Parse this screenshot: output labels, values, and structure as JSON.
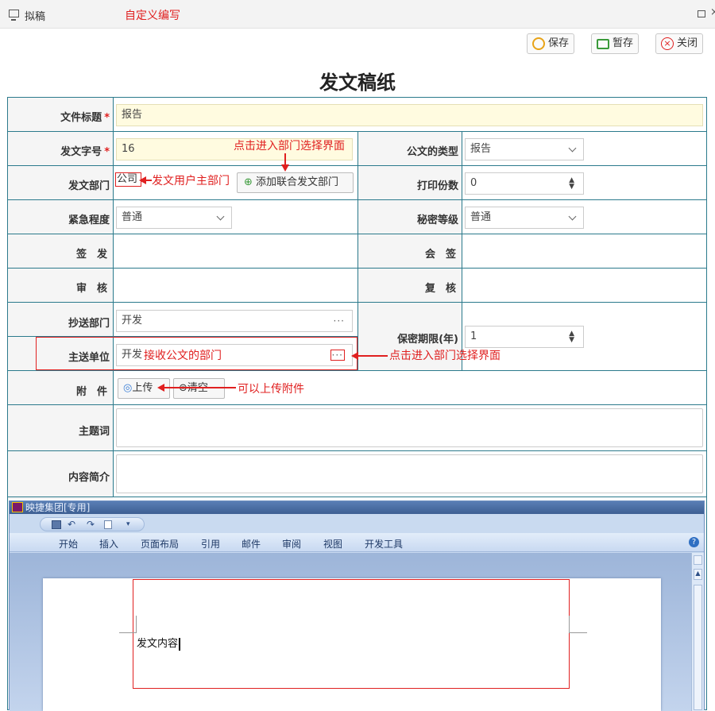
{
  "window": {
    "title": "拟稿",
    "custom_note": "自定义编写",
    "close_glyph": "×"
  },
  "toolbar": {
    "save_label": "保存",
    "draft_label": "暂存",
    "close_label": "关闭"
  },
  "doc_title": "发文稿纸",
  "form": {
    "file_title": {
      "label": "文件标题",
      "required_mark": "*",
      "value": "报告"
    },
    "doc_number": {
      "label": "发文字号",
      "required_mark": "*",
      "value": "16"
    },
    "doc_type": {
      "label": "公文的类型",
      "value": "报告"
    },
    "dept": {
      "label": "发文部门",
      "value": "公司",
      "add_button": "添加联合发文部门"
    },
    "print_count": {
      "label": "打印份数",
      "value": "0"
    },
    "urgency": {
      "label": "紧急程度",
      "value": "普通"
    },
    "secret_level": {
      "label": "秘密等级",
      "value": "普通"
    },
    "sign": {
      "label": "签　发"
    },
    "countersign": {
      "label": "会　签"
    },
    "review": {
      "label": "审　核"
    },
    "recheck": {
      "label": "复　核"
    },
    "cc_dept": {
      "label": "抄送部门",
      "value": "开发",
      "dots": "···"
    },
    "main_unit": {
      "label": "主送单位",
      "value": "开发",
      "dots": "···"
    },
    "keep_period": {
      "label": "保密期限(年)",
      "value": "1"
    },
    "attachment": {
      "label": "附　件",
      "upload_label": "上传",
      "clear_label": "清空"
    },
    "keywords": {
      "label": "主题词"
    },
    "summary": {
      "label": "内容简介"
    }
  },
  "annotations": {
    "dept_select_top": "点击进入部门选择界面",
    "user_dept": "发文用户主部门",
    "receive_dept": "接收公文的部门",
    "dept_select_right": "点击进入部门选择界面",
    "upload_hint": "可以上传附件"
  },
  "word": {
    "title": "映捷集团[专用]",
    "tabs": [
      "开始",
      "插入",
      "页面布局",
      "引用",
      "邮件",
      "审阅",
      "视图",
      "开发工具"
    ],
    "content": "发文内容",
    "help": "?"
  }
}
